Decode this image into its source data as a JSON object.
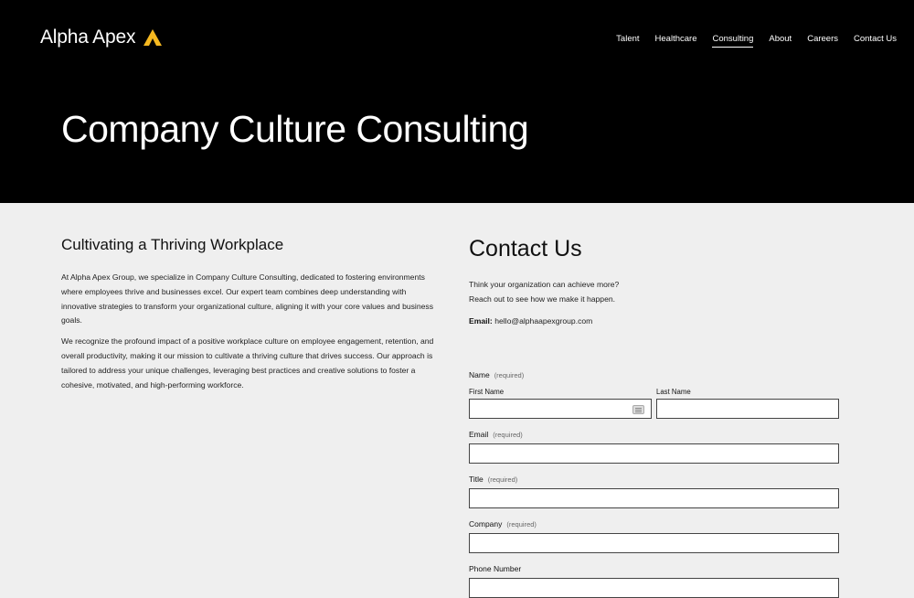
{
  "header": {
    "logo_text": "Alpha Apex",
    "logo_icon": "caret-up-icon",
    "accent": "#f5b820",
    "nav": [
      {
        "label": "Talent",
        "active": false
      },
      {
        "label": "Healthcare",
        "active": false
      },
      {
        "label": "Consulting",
        "active": true
      },
      {
        "label": "About",
        "active": false
      },
      {
        "label": "Careers",
        "active": false
      },
      {
        "label": "Contact Us",
        "active": false
      }
    ]
  },
  "hero": {
    "title": "Company Culture Consulting"
  },
  "content": {
    "heading": "Cultivating a Thriving Workplace",
    "paragraphs": [
      "At Alpha Apex Group, we specialize in Company Culture Consulting, dedicated to fostering environments where employees thrive and businesses excel. Our expert team combines deep understanding with innovative strategies to transform your organizational culture, aligning it with your core values and business goals.",
      "We recognize the profound impact of a positive workplace culture on employee engagement, retention, and overall productivity, making it our mission to cultivate a thriving culture that drives success. Our approach is tailored to address your unique challenges, leveraging best practices and creative solutions to foster a cohesive, motivated, and high-performing workforce."
    ]
  },
  "contact": {
    "heading": "Contact Us",
    "intro_line1": "Think your organization can achieve more?",
    "intro_line2": "Reach out to see how we make it happen.",
    "email_label": "Email:",
    "email_value": "hello@alphaapexgroup.com"
  },
  "form": {
    "name_label": "Name",
    "required_text": "(required)",
    "first_name_label": "First Name",
    "last_name_label": "Last Name",
    "email_label": "Email",
    "title_label": "Title",
    "company_label": "Company",
    "phone_label": "Phone Number"
  }
}
